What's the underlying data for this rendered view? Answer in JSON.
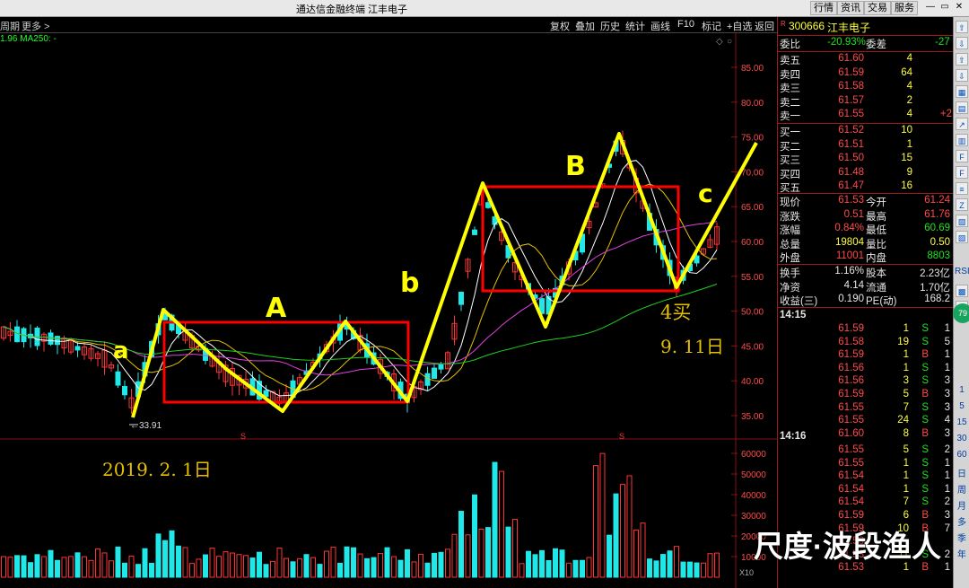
{
  "window": {
    "title": "通达信金融终端  江丰电子",
    "buttons": [
      "行情",
      "资讯",
      "交易",
      "服务"
    ]
  },
  "toolbar": {
    "left_items": [
      "周期",
      "更多 >"
    ],
    "right_items": [
      "复权",
      "叠加",
      "历史",
      "统计",
      "画线",
      "F10",
      "标记",
      "+自选",
      "返回"
    ]
  },
  "indicator_label": "1.96  MA250: -",
  "chart": {
    "y_labels": [
      "85.00",
      "80.00",
      "75.00",
      "70.00",
      "65.00",
      "60.00",
      "55.00",
      "50.00",
      "45.00",
      "40.00",
      "35.00"
    ],
    "low_marker": "33.91",
    "vol_labels": [
      "60000",
      "50000",
      "40000",
      "30000",
      "20000",
      "10000"
    ],
    "vol_unit": "X10",
    "annotations": {
      "a": "a",
      "A": "A",
      "b": "b",
      "B": "B",
      "c": "c",
      "buy4": "4买",
      "date1": "9. 11日",
      "date2": "2019. 2. 1日"
    },
    "colors": {
      "up": "#ff3333",
      "down": "#20e8e8",
      "zigzag": "#ffff00",
      "box": "#ff0000"
    }
  },
  "quote": {
    "marker": "R",
    "code": "300666",
    "name": "江丰电子",
    "weibi_label": "委比",
    "weibi_value": "-20.93%",
    "weicha_label": "委差",
    "weicha_value": "-27",
    "sell": [
      {
        "label": "卖五",
        "price": "61.60",
        "vol": "4",
        "chg": ""
      },
      {
        "label": "卖四",
        "price": "61.59",
        "vol": "64",
        "chg": ""
      },
      {
        "label": "卖三",
        "price": "61.58",
        "vol": "4",
        "chg": ""
      },
      {
        "label": "卖二",
        "price": "61.57",
        "vol": "2",
        "chg": ""
      },
      {
        "label": "卖一",
        "price": "61.55",
        "vol": "4",
        "chg": "+2"
      }
    ],
    "buy": [
      {
        "label": "买一",
        "price": "61.52",
        "vol": "10"
      },
      {
        "label": "买二",
        "price": "61.51",
        "vol": "1"
      },
      {
        "label": "买三",
        "price": "61.50",
        "vol": "15"
      },
      {
        "label": "买四",
        "price": "61.48",
        "vol": "9"
      },
      {
        "label": "买五",
        "price": "61.47",
        "vol": "16"
      }
    ],
    "stats": [
      {
        "l1": "现价",
        "v1": "61.53",
        "c1": "red",
        "l2": "今开",
        "v2": "61.24",
        "c2": "red"
      },
      {
        "l1": "涨跌",
        "v1": "0.51",
        "c1": "red",
        "l2": "最高",
        "v2": "61.76",
        "c2": "red"
      },
      {
        "l1": "涨幅",
        "v1": "0.84%",
        "c1": "red",
        "l2": "最低",
        "v2": "60.69",
        "c2": "green"
      },
      {
        "l1": "总量",
        "v1": "19804",
        "c1": "yel",
        "l2": "量比",
        "v2": "0.50",
        "c2": "yel"
      },
      {
        "l1": "外盘",
        "v1": "11001",
        "c1": "red",
        "l2": "内盘",
        "v2": "8803",
        "c2": "green"
      }
    ],
    "fund": [
      {
        "l1": "换手",
        "v1": "1.16%",
        "l2": "股本",
        "v2": "2.23亿"
      },
      {
        "l1": "净资",
        "v1": "4.14",
        "l2": "流通",
        "v2": "1.70亿"
      },
      {
        "l1": "收益(三)",
        "v1": "0.190",
        "l2": "PE(动)",
        "v2": "168.2"
      }
    ],
    "ticks1_time": "14:15",
    "ticks1": [
      {
        "p": "61.59",
        "v": "1",
        "s": "S",
        "n": "1"
      },
      {
        "p": "61.58",
        "v": "19",
        "s": "S",
        "n": "5"
      },
      {
        "p": "61.59",
        "v": "1",
        "s": "B",
        "n": "1"
      },
      {
        "p": "61.56",
        "v": "1",
        "s": "S",
        "n": "1"
      },
      {
        "p": "61.56",
        "v": "3",
        "s": "S",
        "n": "3"
      },
      {
        "p": "61.59",
        "v": "5",
        "s": "B",
        "n": "3"
      },
      {
        "p": "61.55",
        "v": "7",
        "s": "S",
        "n": "3"
      },
      {
        "p": "61.55",
        "v": "24",
        "s": "S",
        "n": "4"
      },
      {
        "p": "61.60",
        "v": "8",
        "s": "B",
        "n": "3"
      }
    ],
    "ticks2_time": "14:16",
    "ticks2": [
      {
        "p": "61.55",
        "v": "5",
        "s": "S",
        "n": "2"
      },
      {
        "p": "61.55",
        "v": "1",
        "s": "S",
        "n": "1"
      },
      {
        "p": "61.54",
        "v": "1",
        "s": "S",
        "n": "1"
      },
      {
        "p": "61.54",
        "v": "1",
        "s": "S",
        "n": "1"
      },
      {
        "p": "61.54",
        "v": "7",
        "s": "S",
        "n": "2"
      },
      {
        "p": "61.59",
        "v": "6",
        "s": "B",
        "n": "3"
      },
      {
        "p": "61.59",
        "v": "10",
        "s": "B",
        "n": "7"
      },
      {
        "p": "61.58",
        "v": "",
        "s": "",
        "n": ""
      },
      {
        "p": "61.53",
        "v": "11",
        "s": "S",
        "n": "2"
      },
      {
        "p": "61.53",
        "v": "1",
        "s": "B",
        "n": "1"
      }
    ]
  },
  "sidebar": {
    "badge": "79",
    "labels": [
      "RSI",
      "1",
      "5",
      "15",
      "30",
      "60",
      "日",
      "周",
      "月",
      "多",
      "季",
      "年"
    ]
  },
  "watermark": "尺度·波段渔人"
}
